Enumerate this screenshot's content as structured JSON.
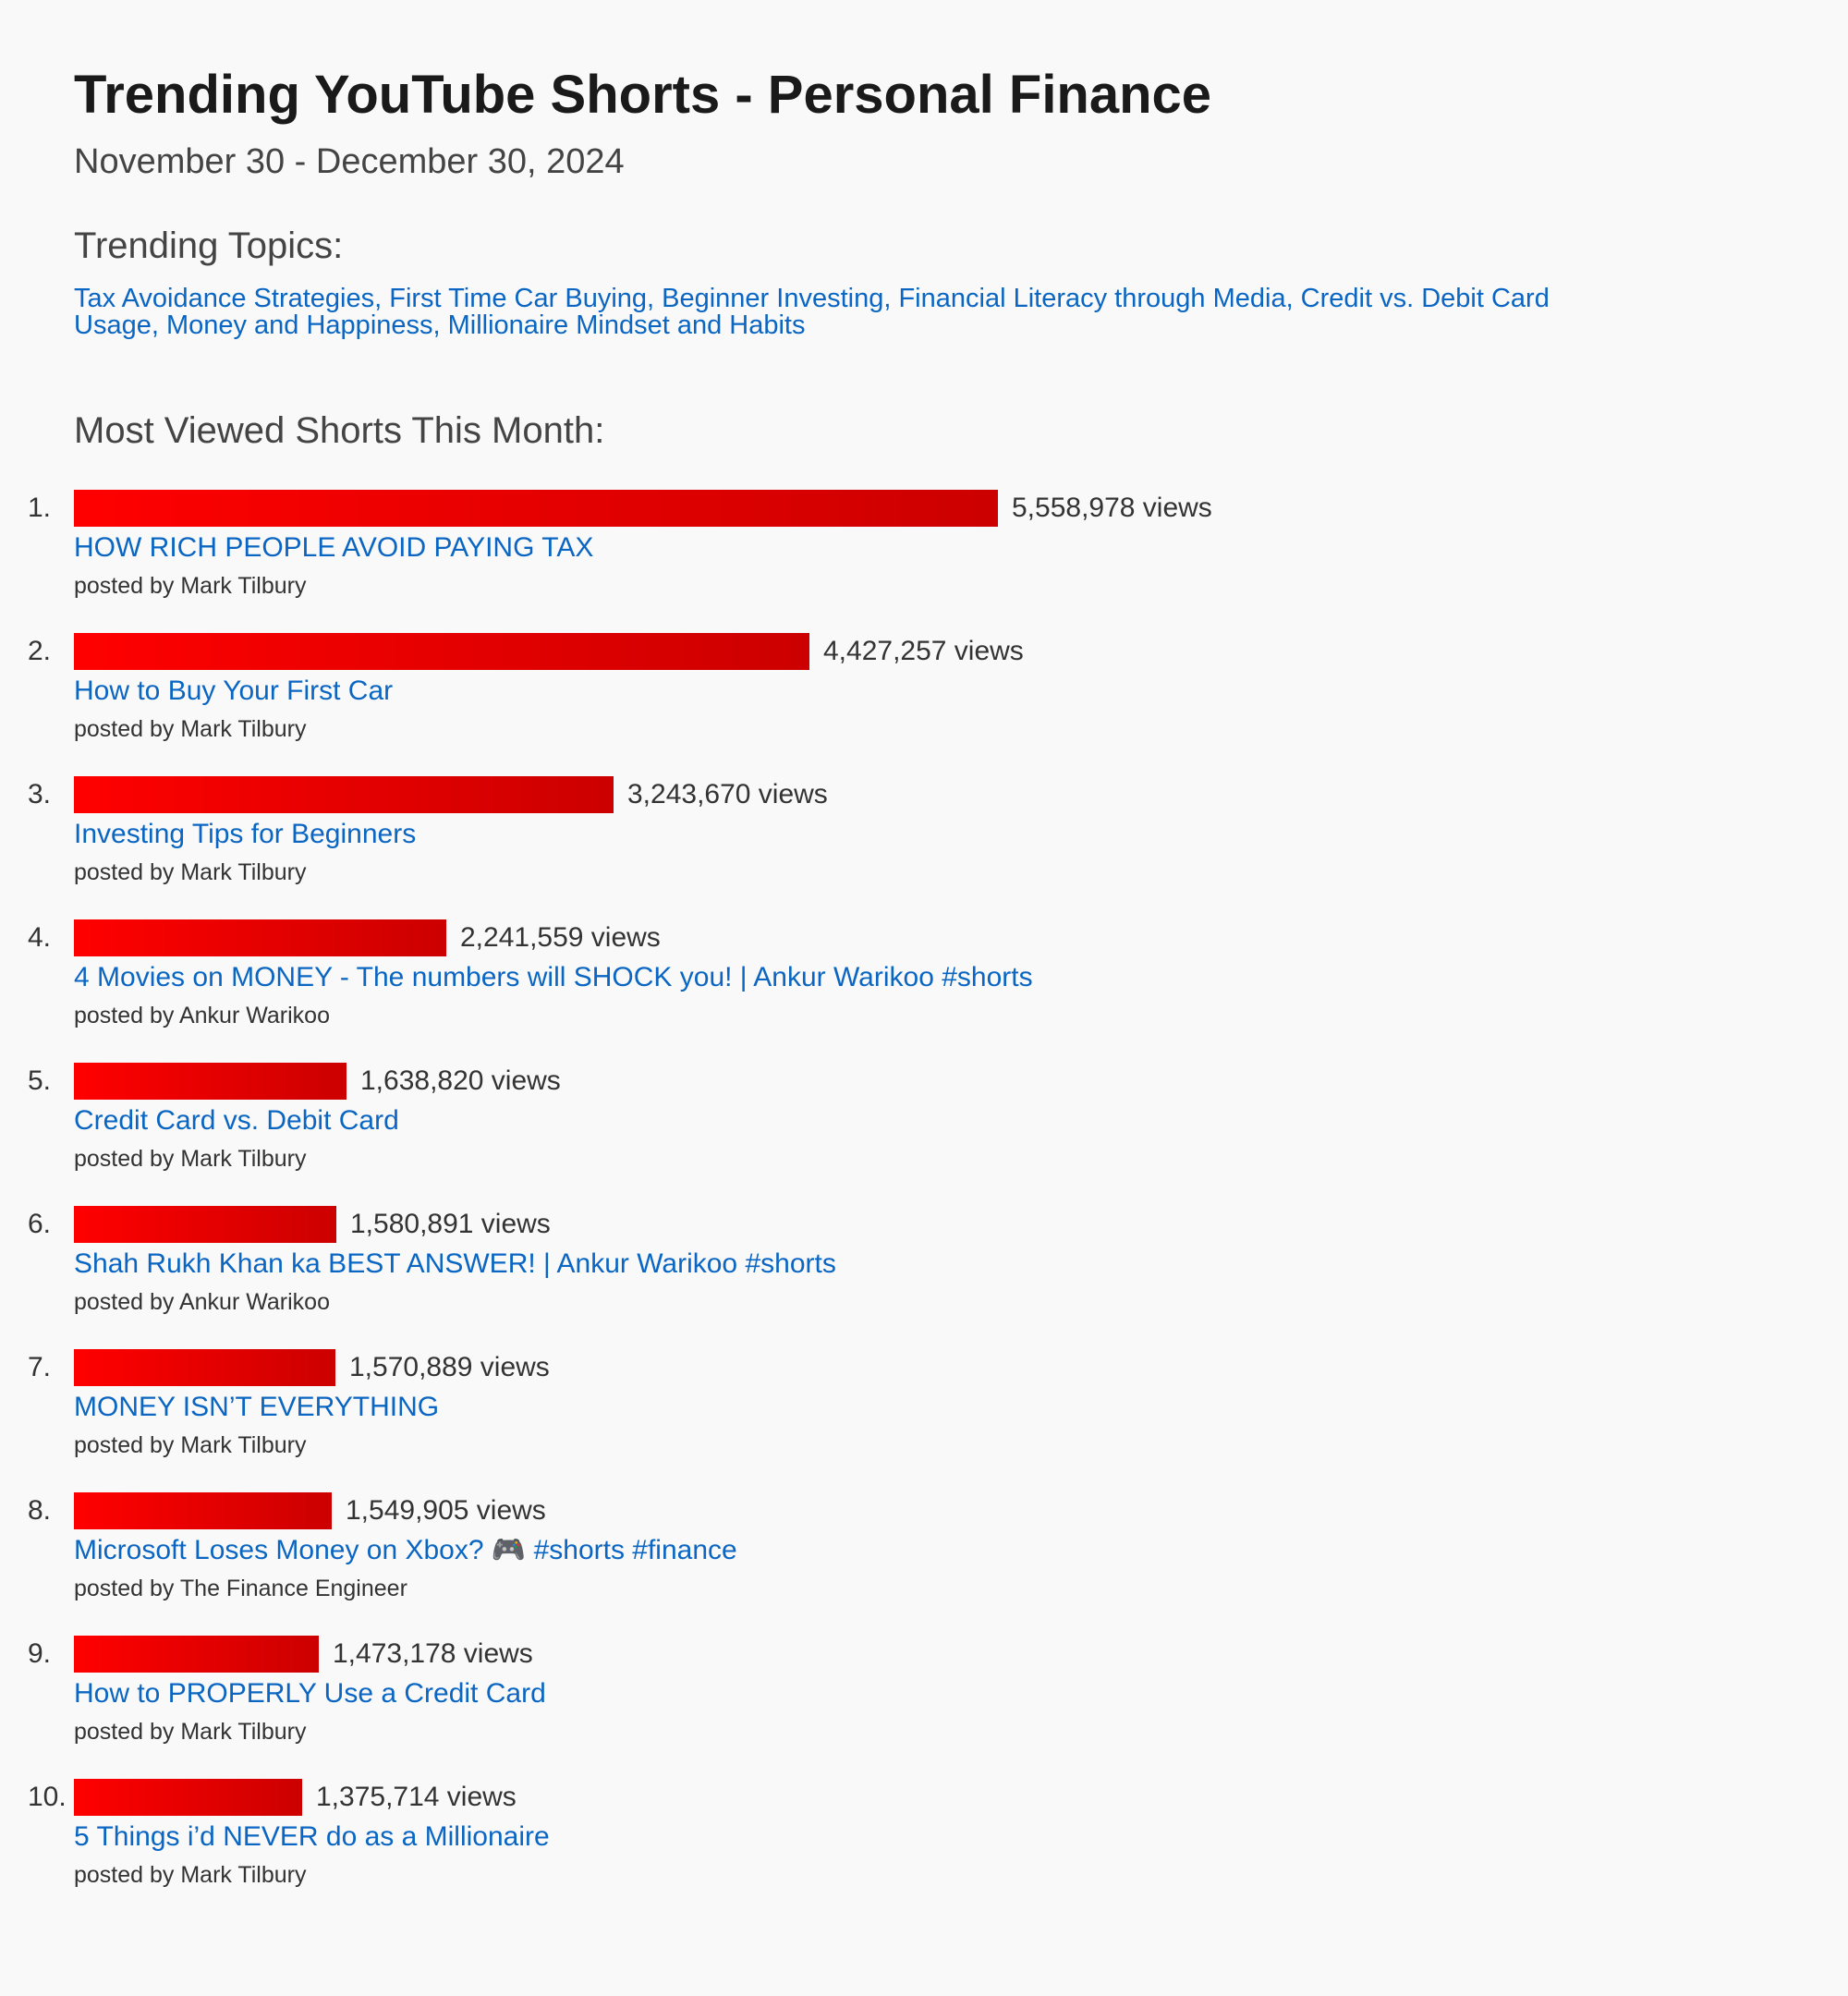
{
  "title": "Trending YouTube Shorts - Personal Finance",
  "subtitle": "November 30 - December 30, 2024",
  "topics_heading": "Trending Topics:",
  "topics_text": "Tax Avoidance Strategies, First Time Car Buying, Beginner Investing, Financial Literacy through Media, Credit vs. Debit Card Usage, Money and Happiness, Millionaire Mindset and Habits",
  "most_viewed_heading": "Most Viewed Shorts This Month:",
  "colors": {
    "bar_start": "#ff0000",
    "bar_end": "#cc0000",
    "link": "#0a66c2"
  },
  "chart_data": {
    "type": "bar",
    "orientation": "horizontal",
    "title": "Most Viewed Shorts This Month:",
    "value_suffix": " views",
    "items": [
      {
        "rank": "1.",
        "views": 5558978,
        "views_label": "5,558,978 views",
        "video_title": "HOW RICH PEOPLE AVOID PAYING TAX",
        "posted_by": "posted by Mark Tilbury"
      },
      {
        "rank": "2.",
        "views": 4427257,
        "views_label": "4,427,257 views",
        "video_title": "How to Buy Your First Car",
        "posted_by": "posted by Mark Tilbury"
      },
      {
        "rank": "3.",
        "views": 3243670,
        "views_label": "3,243,670 views",
        "video_title": "Investing Tips for Beginners",
        "posted_by": "posted by Mark Tilbury"
      },
      {
        "rank": "4.",
        "views": 2241559,
        "views_label": "2,241,559 views",
        "video_title": "4 Movies on MONEY - The numbers will SHOCK you! | Ankur Warikoo #shorts",
        "posted_by": "posted by Ankur Warikoo"
      },
      {
        "rank": "5.",
        "views": 1638820,
        "views_label": "1,638,820 views",
        "video_title": "Credit Card vs. Debit Card",
        "posted_by": "posted by Mark Tilbury"
      },
      {
        "rank": "6.",
        "views": 1580891,
        "views_label": "1,580,891 views",
        "video_title": "Shah Rukh Khan ka BEST ANSWER! | Ankur Warikoo #shorts",
        "posted_by": "posted by Ankur Warikoo"
      },
      {
        "rank": "7.",
        "views": 1570889,
        "views_label": "1,570,889 views",
        "video_title": "MONEY ISN’T EVERYTHING",
        "posted_by": "posted by Mark Tilbury"
      },
      {
        "rank": "8.",
        "views": 1549905,
        "views_label": "1,549,905 views",
        "video_title": "Microsoft Loses Money on Xbox? 🎮 #shorts #finance",
        "posted_by": "posted by The Finance Engineer"
      },
      {
        "rank": "9.",
        "views": 1473178,
        "views_label": "1,473,178 views",
        "video_title": "How to PROPERLY Use a Credit Card",
        "posted_by": "posted by Mark Tilbury"
      },
      {
        "rank": "10.",
        "views": 1375714,
        "views_label": "1,375,714 views",
        "video_title": "5 Things i’d NEVER do as a Millionaire",
        "posted_by": "posted by Mark Tilbury"
      }
    ]
  }
}
